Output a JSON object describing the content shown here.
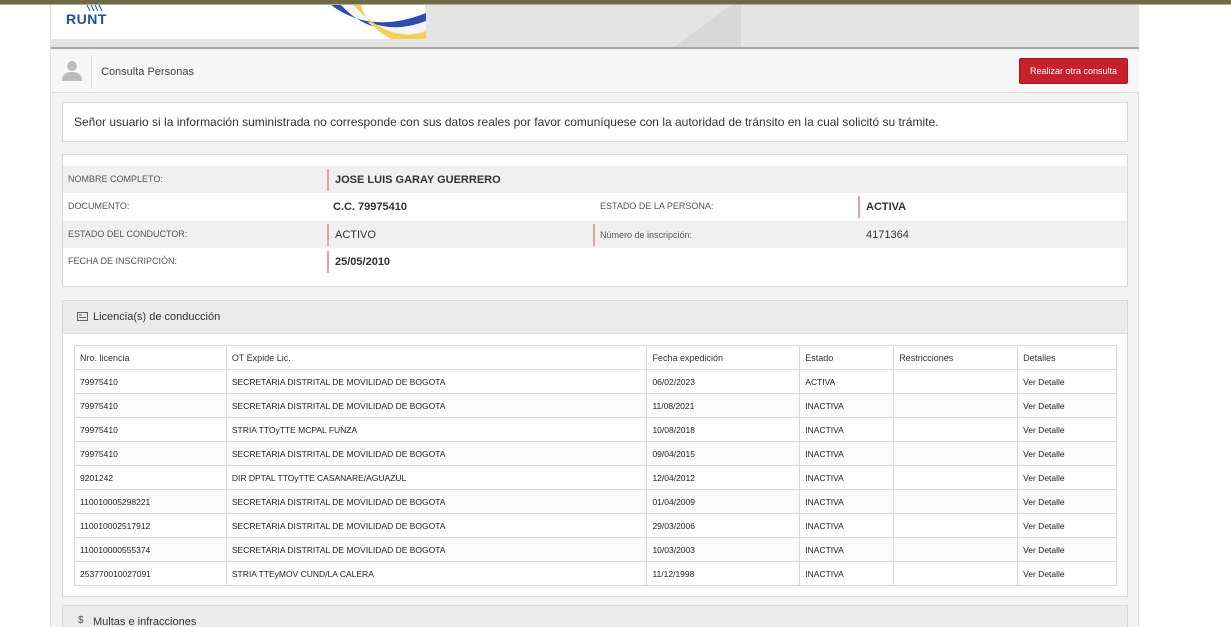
{
  "header": {
    "logo_text": "RUNT",
    "section_title": "Consulta Personas",
    "new_query_button": "Realizar otra consulta"
  },
  "notice": "Señor usuario si la información suministrada no corresponde con sus datos reales por favor comuníquese con la autoridad de tránsito en la cual solicitó su trámite.",
  "person": {
    "full_name_label": "NOMBRE COMPLETO:",
    "full_name": "JOSE LUIS GARAY GUERRERO",
    "document_label": "DOCUMENTO:",
    "document": "C.C. 79975410",
    "person_status_label": "ESTADO DE LA PERSONA:",
    "person_status": "ACTIVA",
    "driver_status_label": "ESTADO DEL CONDUCTOR:",
    "driver_status": "ACTIVO",
    "registration_number_label": "Número de inscripción:",
    "registration_number": "4171364",
    "registration_date_label": "FECHA DE INSCRIPCIÓN:",
    "registration_date": "25/05/2010"
  },
  "licenses": {
    "title": "Licencia(s) de conducción",
    "columns": [
      "Nro. licencia",
      "OT Expide Lic.",
      "Fecha expedición",
      "Estado",
      "Restricciones",
      "Detalles"
    ],
    "rows": [
      {
        "number": "79975410",
        "issuer": "SECRETARIA DISTRITAL DE MOVILIDAD DE BOGOTA",
        "date": "06/02/2023",
        "status": "ACTIVA",
        "restrictions": "",
        "details": "Ver Detalle"
      },
      {
        "number": "79975410",
        "issuer": "SECRETARIA DISTRITAL DE MOVILIDAD DE BOGOTA",
        "date": "11/08/2021",
        "status": "INACTIVA",
        "restrictions": "",
        "details": "Ver Detalle"
      },
      {
        "number": "79975410",
        "issuer": "STRIA TTOyTTE MCPAL FUNZA",
        "date": "10/08/2018",
        "status": "INACTIVA",
        "restrictions": "",
        "details": "Ver Detalle"
      },
      {
        "number": "79975410",
        "issuer": "SECRETARIA DISTRITAL DE MOVILIDAD DE BOGOTA",
        "date": "09/04/2015",
        "status": "INACTIVA",
        "restrictions": "",
        "details": "Ver Detalle"
      },
      {
        "number": "9201242",
        "issuer": "DIR DPTAL TTOyTTE CASANARE/AGUAZUL",
        "date": "12/04/2012",
        "status": "INACTIVA",
        "restrictions": "",
        "details": "Ver Detalle"
      },
      {
        "number": "110010005298221",
        "issuer": "SECRETARIA DISTRITAL DE MOVILIDAD DE BOGOTA",
        "date": "01/04/2009",
        "status": "INACTIVA",
        "restrictions": "",
        "details": "Ver Detalle"
      },
      {
        "number": "110010002517912",
        "issuer": "SECRETARIA DISTRITAL DE MOVILIDAD DE BOGOTA",
        "date": "29/03/2006",
        "status": "INACTIVA",
        "restrictions": "",
        "details": "Ver Detalle"
      },
      {
        "number": "110010000555374",
        "issuer": "SECRETARIA DISTRITAL DE MOVILIDAD DE BOGOTA",
        "date": "10/03/2003",
        "status": "INACTIVA",
        "restrictions": "",
        "details": "Ver Detalle"
      },
      {
        "number": "253770010027091",
        "issuer": "STRIA TTEyMOV CUND/LA CALERA",
        "date": "11/12/1998",
        "status": "INACTIVA",
        "restrictions": "",
        "details": "Ver Detalle"
      }
    ]
  },
  "fines": {
    "title": "Multas e infracciones",
    "icon": "$"
  }
}
